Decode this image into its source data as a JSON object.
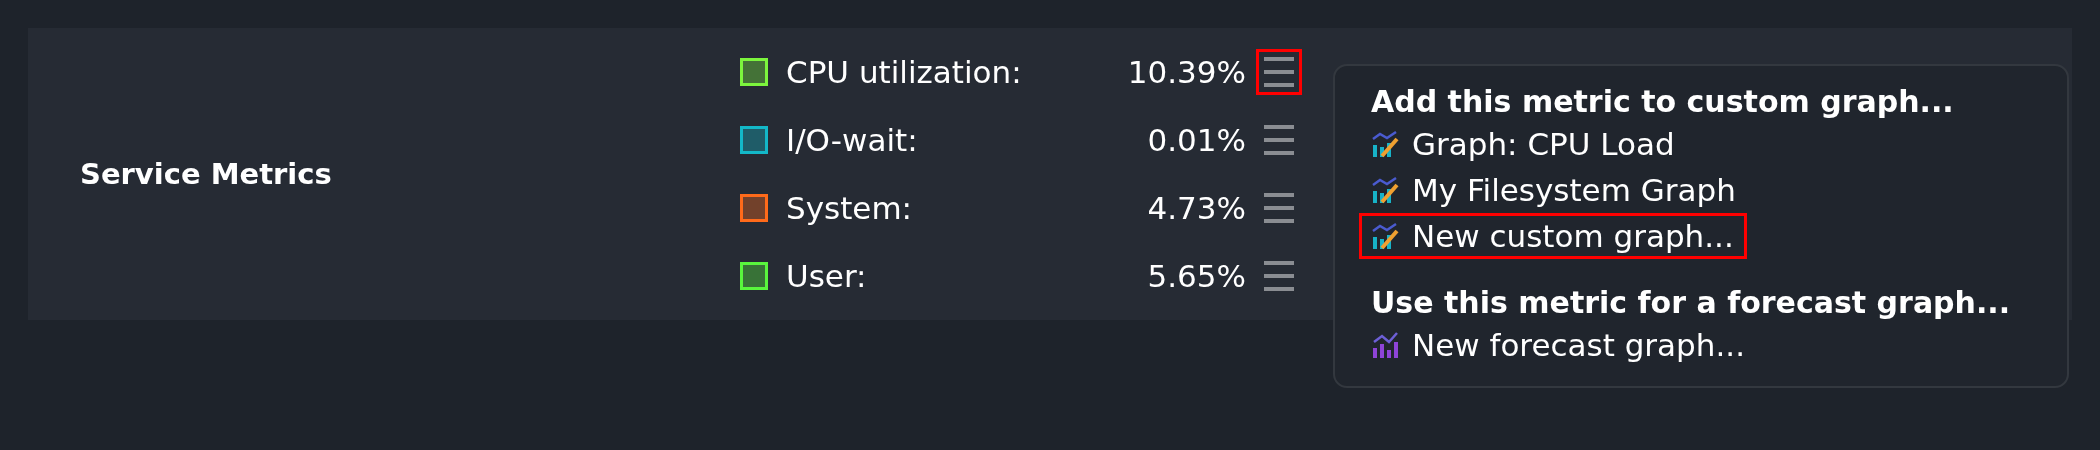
{
  "section": {
    "title": "Service Metrics"
  },
  "metrics": [
    {
      "name": "CPU utilization:",
      "value": "10.39%",
      "color": "#7cf53d",
      "highlighted": true
    },
    {
      "name": "I/O-wait:",
      "value": "0.01%",
      "color": "#13b8c8",
      "highlighted": false
    },
    {
      "name": "System:",
      "value": "4.73%",
      "color": "#ff6a1a",
      "highlighted": false
    },
    {
      "name": "User:",
      "value": "5.65%",
      "color": "#59f53d",
      "highlighted": false
    }
  ],
  "menu": {
    "groups": [
      {
        "heading": "Add this metric to custom graph...",
        "items": [
          {
            "label": "Graph: CPU Load",
            "kind": "custom",
            "highlighted": false
          },
          {
            "label": "My Filesystem Graph",
            "kind": "custom",
            "highlighted": false
          },
          {
            "label": "New custom graph...",
            "kind": "custom",
            "highlighted": true
          }
        ]
      },
      {
        "heading": "Use this metric for a forecast graph...",
        "items": [
          {
            "label": "New forecast graph...",
            "kind": "forecast",
            "highlighted": false
          }
        ]
      }
    ]
  }
}
